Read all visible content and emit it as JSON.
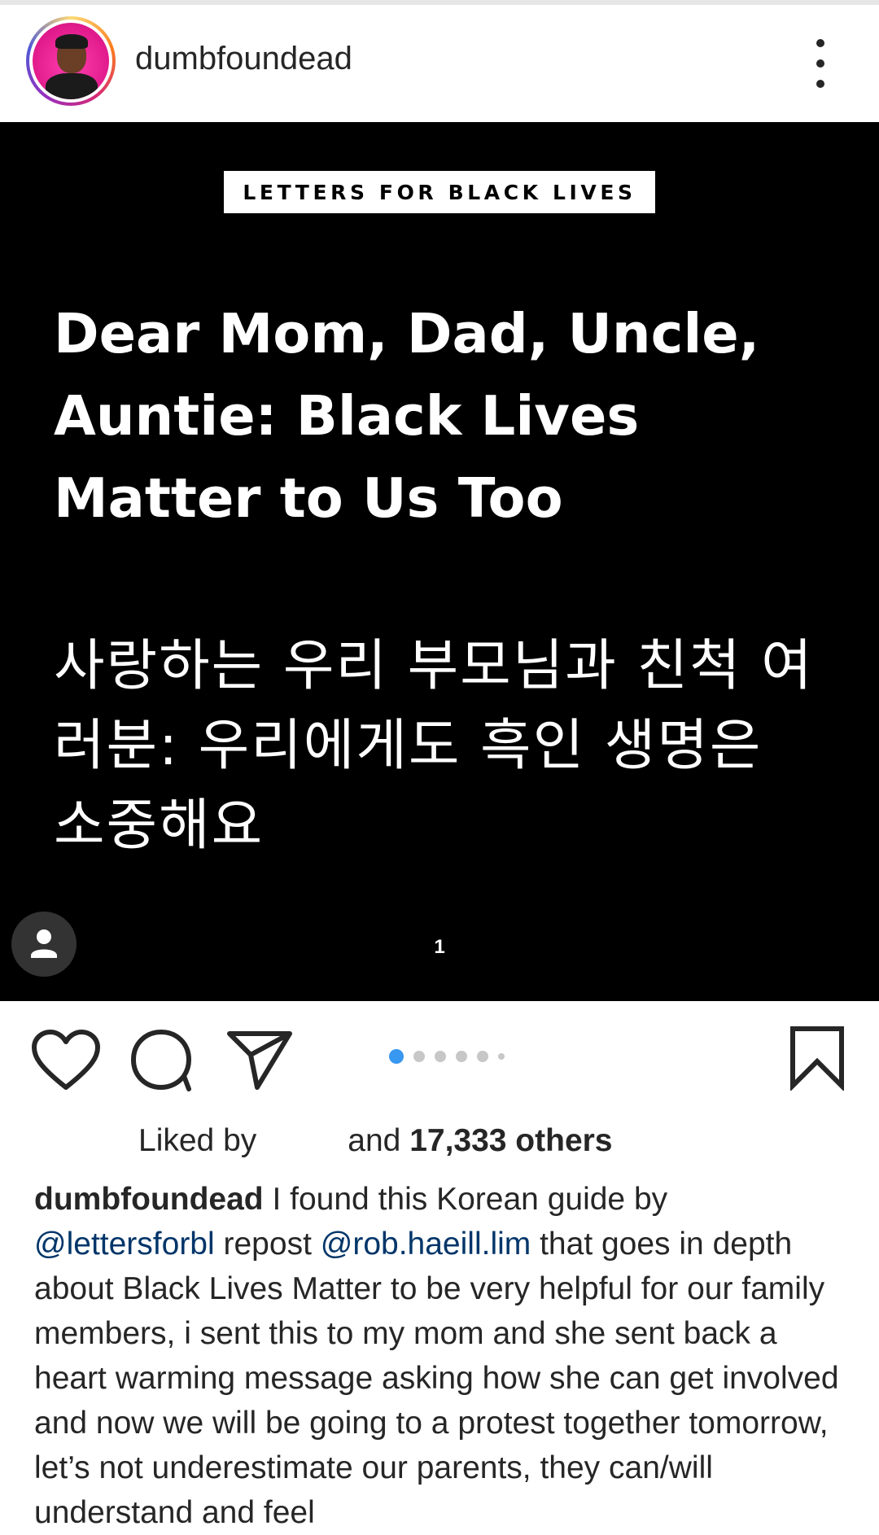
{
  "header": {
    "username": "dumbfoundead",
    "avatar_icon": "profile-avatar",
    "more_icon": "more-vertical-icon"
  },
  "post": {
    "banner": "LETTERS FOR BLACK LIVES",
    "headline_lines": [
      "Dear Mom, Dad, Uncle,",
      "Auntie: Black Lives",
      "Matter to Us Too"
    ],
    "headline_kr_lines": [
      "사랑하는 우리 부모님과 친척 여",
      "러분: 우리에게도 흑인 생명은",
      "소중해요"
    ],
    "slide_number": "1",
    "tag_icon": "user-tag-icon"
  },
  "actions": {
    "like_icon": "heart-icon",
    "comment_icon": "comment-icon",
    "share_icon": "send-icon",
    "save_icon": "bookmark-icon",
    "carousel_dots": 6,
    "active_dot": 1,
    "accent_color": "#3897f0"
  },
  "likes": {
    "prefix": "Liked by",
    "middle": "and",
    "count": "17,333 others"
  },
  "caption": {
    "username": "dumbfoundead",
    "text1": " I found this Korean guide by ",
    "mention1": "@lettersforbl",
    "text2": " repost ",
    "mention2": "@rob.haeill.lim",
    "text3": " that goes in depth about Black Lives Matter to be very helpful for our family members, i sent this to my mom and she sent back a heart warming message asking how she can get involved and now we will be going to a protest together tomorrow, let’s not underestimate our parents, they can/will understand and feel"
  }
}
